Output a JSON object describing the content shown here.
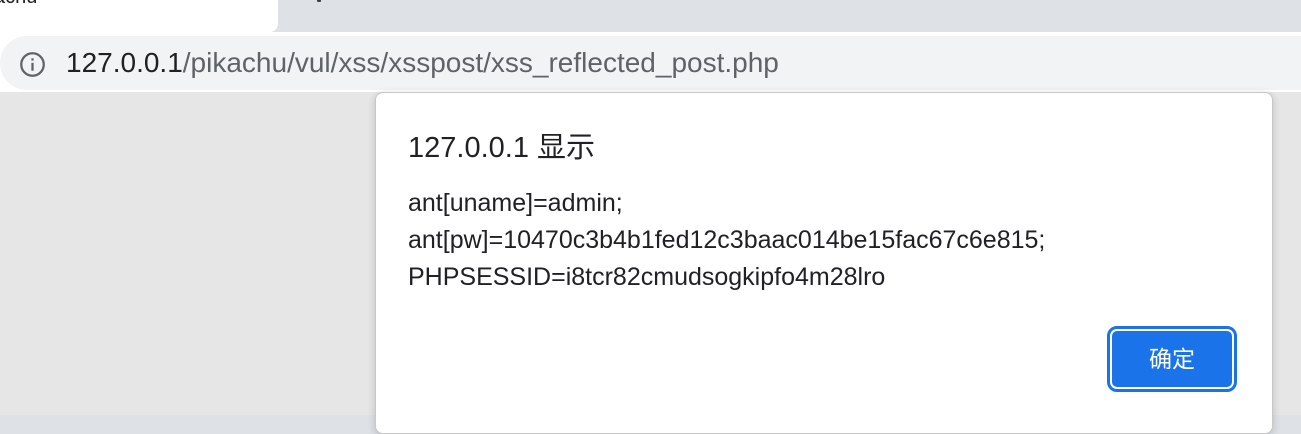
{
  "browser": {
    "active_tab_title": "achu",
    "address": {
      "host": "127.0.0.1",
      "path": "/pikachu/vul/xss/xsspost/xss_reflected_post.php"
    },
    "security_icon": "info-circle-icon"
  },
  "dialog": {
    "title": "127.0.0.1 显示",
    "message_lines": [
      "ant[uname]=admin;",
      "ant[pw]=10470c3b4b1fed12c3baac014be15fac67c6e815;",
      "PHPSESSID=i8tcr82cmudsogkipfo4m28lro"
    ],
    "ok_label": "确定",
    "ok_color": "#1a73e8"
  }
}
